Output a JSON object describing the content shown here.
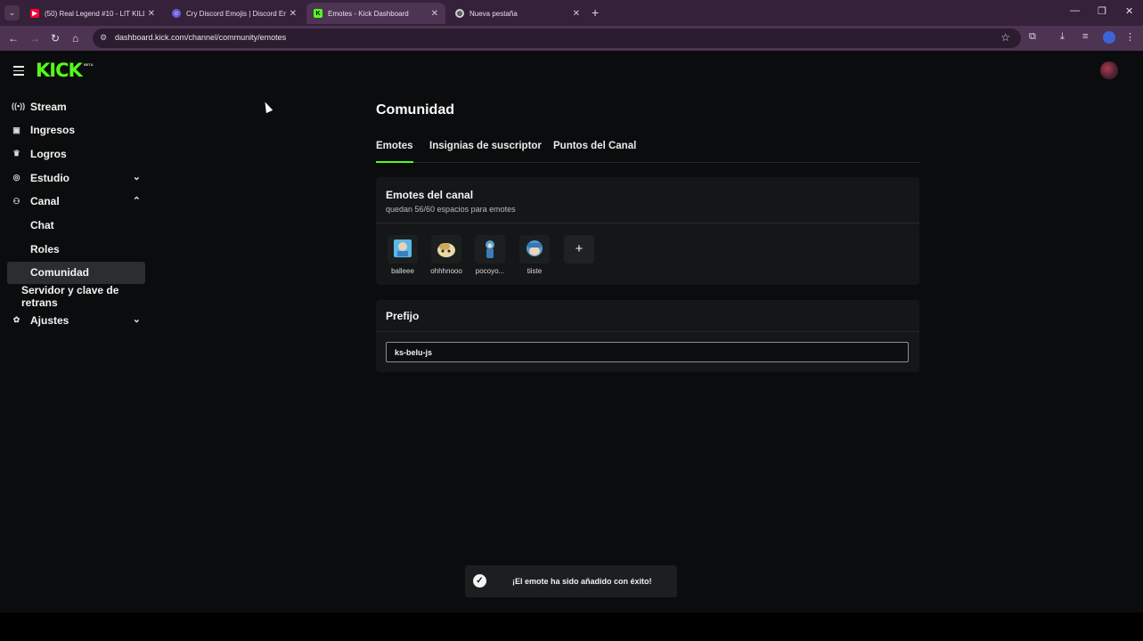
{
  "browser": {
    "tabs": [
      {
        "title": "(50) Real Legend #10 - LIT KILL",
        "favicon": "youtube-icon",
        "color": "#ff0033"
      },
      {
        "title": "Cry Discord Emojis | Discord Em",
        "favicon": "discord-emoji-icon",
        "color": "#6b5bd6"
      },
      {
        "title": "Emotes - Kick Dashboard",
        "favicon": "kick-icon",
        "color": "#53fc18"
      },
      {
        "title": "Nueva pestaña",
        "favicon": "globe-icon",
        "color": "#cfcfcf"
      }
    ],
    "url": "dashboard.kick.com/channel/community/emotes"
  },
  "header": {
    "logo": "KICK",
    "logo_badge": "BETA"
  },
  "sidebar": {
    "items": [
      {
        "label": "Stream",
        "icon": "broadcast-icon"
      },
      {
        "label": "Ingresos",
        "icon": "chart-icon"
      },
      {
        "label": "Logros",
        "icon": "trophy-icon"
      },
      {
        "label": "Estudio",
        "icon": "studio-icon"
      },
      {
        "label": "Canal",
        "icon": "channel-icon"
      },
      {
        "label": "Chat"
      },
      {
        "label": "Roles"
      },
      {
        "label": "Comunidad"
      },
      {
        "label": "Servidor y clave de retrans"
      },
      {
        "label": "Ajustes",
        "icon": "gear-icon"
      }
    ]
  },
  "main": {
    "title": "Comunidad",
    "tabs": [
      "Emotes",
      "Insignias de suscriptor",
      "Puntos del Canal"
    ],
    "emotes_card": {
      "title": "Emotes del canal",
      "subtitle": "quedan 56/60 espacios para emotes",
      "emotes": [
        "balleee",
        "ohhhnooo",
        "pocoyo...",
        "tiiste"
      ]
    },
    "prefix_card": {
      "title": "Prefijo",
      "value": "ks-belu-js"
    }
  },
  "toast": {
    "message": "¡El emote ha sido añadido con éxito!"
  },
  "colors": {
    "accent": "#53fc18",
    "background": "#0b0c0d",
    "card": "#141617"
  }
}
